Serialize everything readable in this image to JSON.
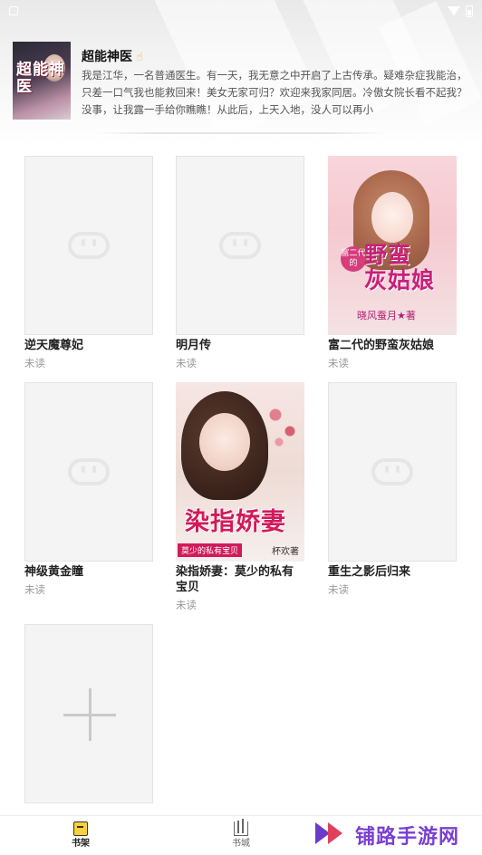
{
  "status_bar": {
    "icons": [
      "notification-icon",
      "wifi-icon",
      "battery-icon"
    ]
  },
  "featured": {
    "title": "超能神医",
    "title_icon": "thumbs-up-icon",
    "description": "我是江华，一名普通医生。有一天，我无意之中开启了上古传承。疑难杂症我能治，只差一口气我也能救回来！美女无家可归？欢迎来我家同居。冷傲女院长看不起我？没事，让我露一手给你瞧瞧！从此后，上天入地，没人可以再小",
    "cover_text": "超能神医"
  },
  "books": [
    {
      "title": "逆天魔尊妃",
      "status": "未读",
      "cover": "placeholder"
    },
    {
      "title": "明月传",
      "status": "未读",
      "cover": "placeholder"
    },
    {
      "title": "富二代的野蛮灰姑娘",
      "status": "未读",
      "cover": "pink",
      "cover_small": "富二代的",
      "cover_big": "野蛮\n灰姑娘",
      "cover_author": "晓风蚕月★著"
    },
    {
      "title": "神级黄金瞳",
      "status": "未读",
      "cover": "placeholder"
    },
    {
      "title": "染指娇妻：莫少的私有宝贝",
      "status": "未读",
      "cover": "beauty",
      "cover_big": "染指娇妻",
      "cover_sub": "莫少的私有宝贝",
      "cover_author": "杯欢著"
    },
    {
      "title": "重生之影后归来",
      "status": "未读",
      "cover": "placeholder"
    }
  ],
  "add_book": {
    "icon": "plus-icon"
  },
  "bottom_nav": [
    {
      "label": "书架",
      "icon": "bookshelf-icon",
      "active": true
    },
    {
      "label": "书城",
      "icon": "bookstore-icon",
      "active": false
    }
  ],
  "watermark": {
    "text": "铺路手游网"
  },
  "colors": {
    "accent": "#f8d23a",
    "muted": "#999999",
    "watermark": "#7a3fd0"
  }
}
